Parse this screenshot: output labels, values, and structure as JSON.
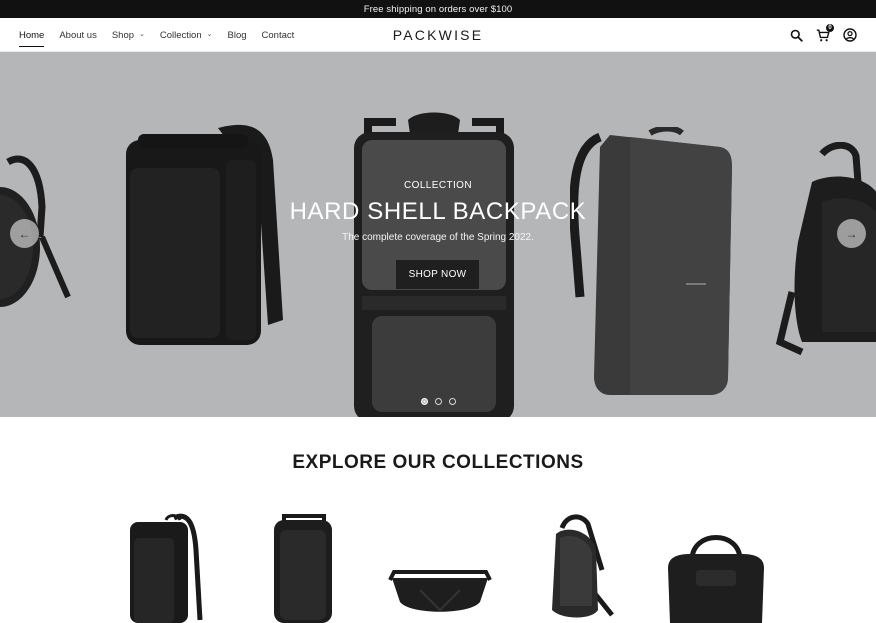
{
  "announcement": "Free shipping on orders over $100",
  "header": {
    "brand": "PACKWISE",
    "nav": [
      {
        "label": "Home",
        "active": true,
        "dropdown": false
      },
      {
        "label": "About us",
        "active": false,
        "dropdown": false
      },
      {
        "label": "Shop",
        "active": false,
        "dropdown": true
      },
      {
        "label": "Collection",
        "active": false,
        "dropdown": true
      },
      {
        "label": "Blog",
        "active": false,
        "dropdown": false
      },
      {
        "label": "Contact",
        "active": false,
        "dropdown": false
      }
    ],
    "icons": [
      "search-icon",
      "cart-icon",
      "account-icon"
    ],
    "cart_count": "0"
  },
  "hero": {
    "kicker": "COLLECTION",
    "title": "HARD SHELL BACKPACK",
    "subtitle": "The complete coverage of the Spring 2022.",
    "button": "SHOP NOW",
    "background": "#b4b6b8",
    "slides_total": 3,
    "active_slide": 1
  },
  "collections": {
    "title": "EXPLORE OUR COLLECTIONS",
    "items": [
      "black-laptop-backpack",
      "hard-shell-backpack",
      "black-crossbody-bag",
      "sling-bag",
      "duffel-bag"
    ]
  }
}
